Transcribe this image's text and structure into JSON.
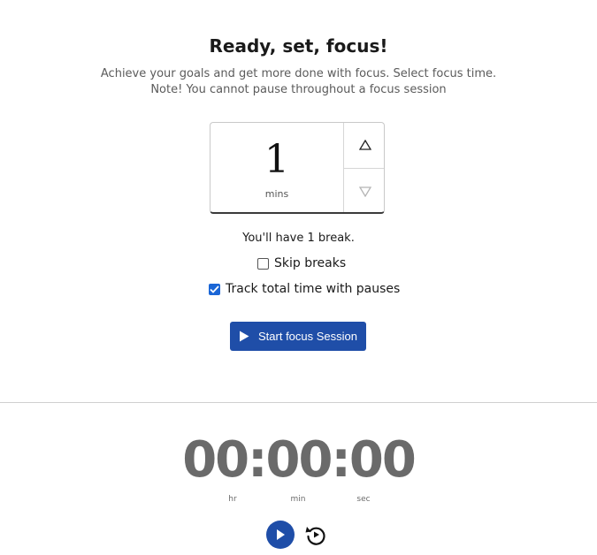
{
  "header": {
    "title": "Ready, set, focus!",
    "subtitle_line1": "Achieve your goals and get more done with focus. Select focus time.",
    "subtitle_line2": "Note! You cannot pause throughout a focus session"
  },
  "picker": {
    "value": "1",
    "unit": "mins",
    "up_icon": "triangle-up-icon",
    "down_icon": "triangle-down-icon"
  },
  "breaks": {
    "summary": "You'll have 1 break.",
    "skip_label": "Skip breaks",
    "skip_checked": false,
    "track_label": "Track total time with pauses",
    "track_checked": true
  },
  "start_button": {
    "label": "Start focus Session",
    "icon": "play-icon"
  },
  "timer": {
    "display": "00:00:00",
    "labels": {
      "hr": "hr",
      "min": "min",
      "sec": "sec"
    }
  },
  "controls": {
    "play_icon": "play-icon",
    "reset_icon": "reset-icon"
  },
  "colors": {
    "accent": "#1f4ea8",
    "checkbox": "#1a66d6",
    "timer_text": "#6a6a6a"
  }
}
